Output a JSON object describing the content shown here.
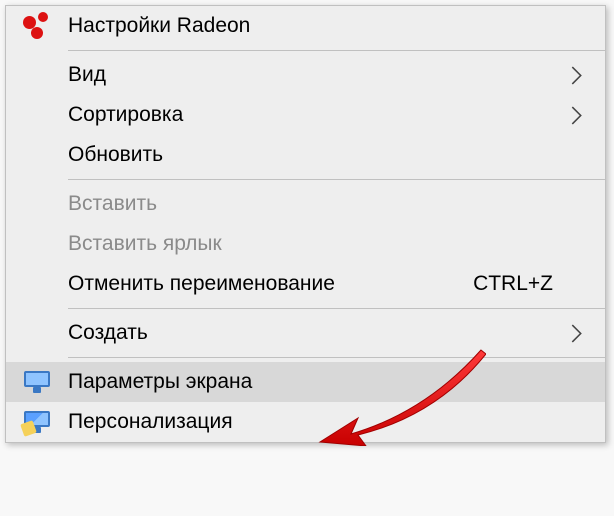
{
  "menu": {
    "radeon": "Настройки Radeon",
    "view": "Вид",
    "sort": "Сортировка",
    "refresh": "Обновить",
    "paste": "Вставить",
    "paste_shortcut": "Вставить ярлык",
    "undo_rename": "Отменить переименование",
    "undo_rename_key": "CTRL+Z",
    "create": "Создать",
    "display_settings": "Параметры экрана",
    "personalize": "Персонализация"
  }
}
